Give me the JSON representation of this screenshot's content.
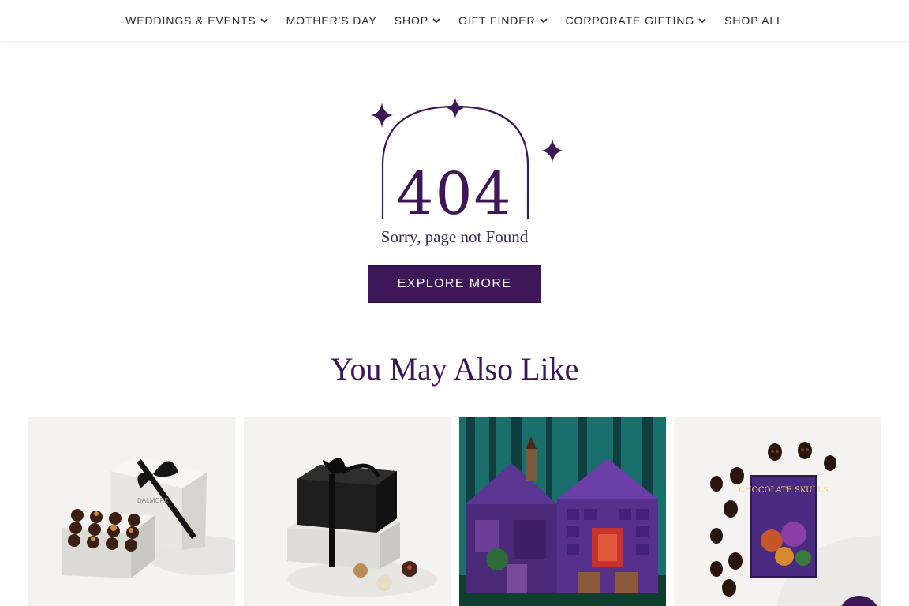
{
  "nav": {
    "items": [
      {
        "label": "WEDDINGS & EVENTS",
        "has_dropdown": true
      },
      {
        "label": "MOTHER'S DAY",
        "has_dropdown": false
      },
      {
        "label": "SHOP",
        "has_dropdown": true
      },
      {
        "label": "GIFT FINDER",
        "has_dropdown": true
      },
      {
        "label": "CORPORATE GIFTING",
        "has_dropdown": true
      },
      {
        "label": "SHOP ALL",
        "has_dropdown": false
      }
    ]
  },
  "error": {
    "code": "404",
    "message": "Sorry, page not Found",
    "button_label": "EXPLORE MORE"
  },
  "recommendations": {
    "title": "You May Also Like",
    "products": [
      {
        "image": "dalmore-truffle-gift-box",
        "box_text": "DALMORE"
      },
      {
        "image": "black-gift-box-with-truffles"
      },
      {
        "image": "purple-house-advent-calendar"
      },
      {
        "image": "chocolate-skulls-box",
        "box_text": "CHOCOLATE SKULLS"
      }
    ]
  },
  "colors": {
    "brand_purple": "#3d1757",
    "nav_text": "#2c2a33"
  }
}
